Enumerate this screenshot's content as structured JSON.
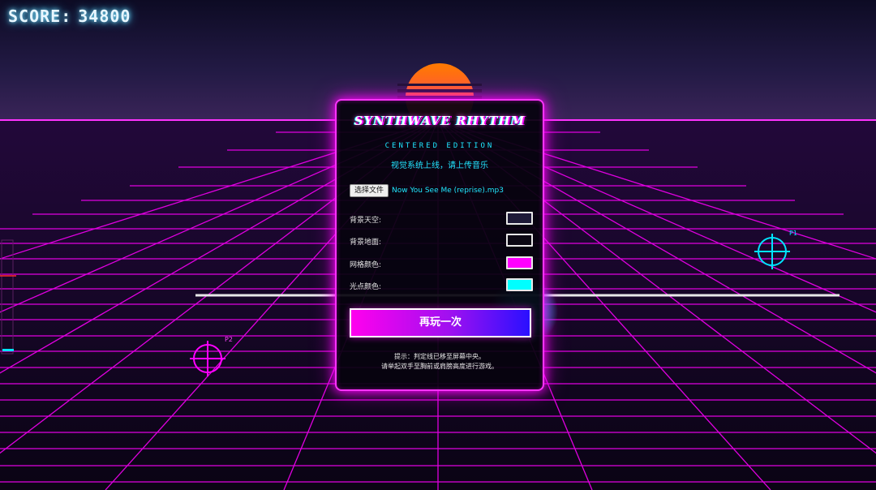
{
  "hud": {
    "score_label": "SCORE:",
    "score_value": "34800"
  },
  "players": {
    "p1_label": "P1",
    "p2_label": "P2"
  },
  "panel": {
    "title": "SYNTHWAVE RHYTHM",
    "edition": "CENTERED EDITION",
    "status": "视觉系统上线，请上传音乐",
    "file_button": "选择文件",
    "file_name": "Now You See Me (reprise).mp3",
    "settings": [
      {
        "label": "背景天空:",
        "color": "#1e1a38"
      },
      {
        "label": "背景地面:",
        "color": "#0c0814"
      },
      {
        "label": "网格颜色:",
        "color": "#ff00ff"
      },
      {
        "label": "光点颜色:",
        "color": "#00ffff"
      }
    ],
    "play_again": "再玩一次",
    "tip_line1": "提示：判定线已移至屏幕中央。",
    "tip_line2": "请举起双手至胸前或肩膀高度进行游戏。"
  },
  "colors": {
    "accent": "#ff00ff",
    "cyan": "#00e5ff",
    "sun": "#ff6a00"
  }
}
